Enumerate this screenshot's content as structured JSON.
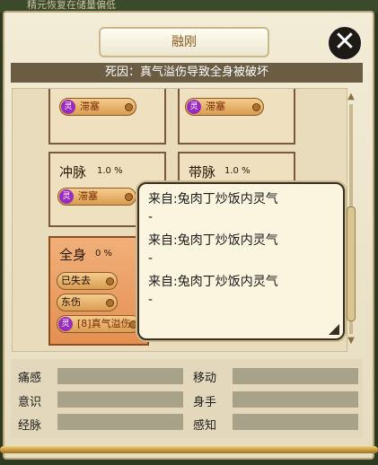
{
  "top_banner": "精元恢复在储量偏低",
  "title": "融刚",
  "death_reason": "死因：真气溢伤导致全身被破坏",
  "cards": {
    "top_left": {
      "tag": "滞塞"
    },
    "top_right": {
      "tag": "滞塞"
    },
    "chongmai": {
      "name": "冲脉",
      "percent": "1.0 %",
      "tag": "滞塞"
    },
    "daimai": {
      "name": "带脉",
      "percent": "1.0 %"
    },
    "quanshen": {
      "name": "全身",
      "percent": "0 %",
      "tags": [
        "已失去",
        "东伤",
        "[8]真气溢伤"
      ]
    }
  },
  "ling_glyph": "灵",
  "tooltip": {
    "lines": [
      "来自:兔肉丁炒饭内灵气",
      "-",
      "来自:兔肉丁炒饭内灵气",
      "-",
      "来自:兔肉丁炒饭内灵气",
      "-"
    ]
  },
  "stats": {
    "tongan": "痛感",
    "yishi": "意识",
    "jingmai": "经脉",
    "yidong": "移动",
    "shenshou": "身手",
    "ganzhi": "感知"
  },
  "icons": [
    "close-icon",
    "ling-icon",
    "scroll-up-icon",
    "scroll-down-icon",
    "resize-icon"
  ]
}
